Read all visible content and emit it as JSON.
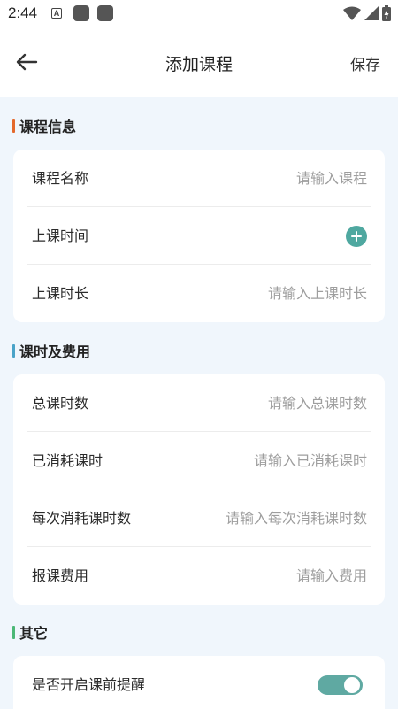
{
  "status": {
    "time": "2:44",
    "notif_a": "A"
  },
  "appbar": {
    "title": "添加课程",
    "save": "保存"
  },
  "colors": {
    "accent": "#4fa8a0",
    "section1_bar": "#e4692c",
    "section2_bar": "#4aa3c8",
    "section3_bar": "#4cb877"
  },
  "sections": [
    {
      "title": "课程信息",
      "rows": [
        {
          "label": "课程名称",
          "placeholder": "请输入课程",
          "value": ""
        },
        {
          "label": "上课时间",
          "action": "plus-icon"
        },
        {
          "label": "上课时长",
          "placeholder": "请输入上课时长",
          "value": ""
        }
      ]
    },
    {
      "title": "课时及费用",
      "rows": [
        {
          "label": "总课时数",
          "placeholder": "请输入总课时数",
          "value": ""
        },
        {
          "label": "已消耗课时",
          "placeholder": "请输入已消耗课时",
          "value": ""
        },
        {
          "label": "每次消耗课时数",
          "placeholder": "请输入每次消耗课时数",
          "value": ""
        },
        {
          "label": "报课费用",
          "placeholder": "请输入费用",
          "value": ""
        }
      ]
    },
    {
      "title": "其它",
      "rows": [
        {
          "label": "是否开启课前提醒",
          "toggle": true
        }
      ]
    }
  ]
}
